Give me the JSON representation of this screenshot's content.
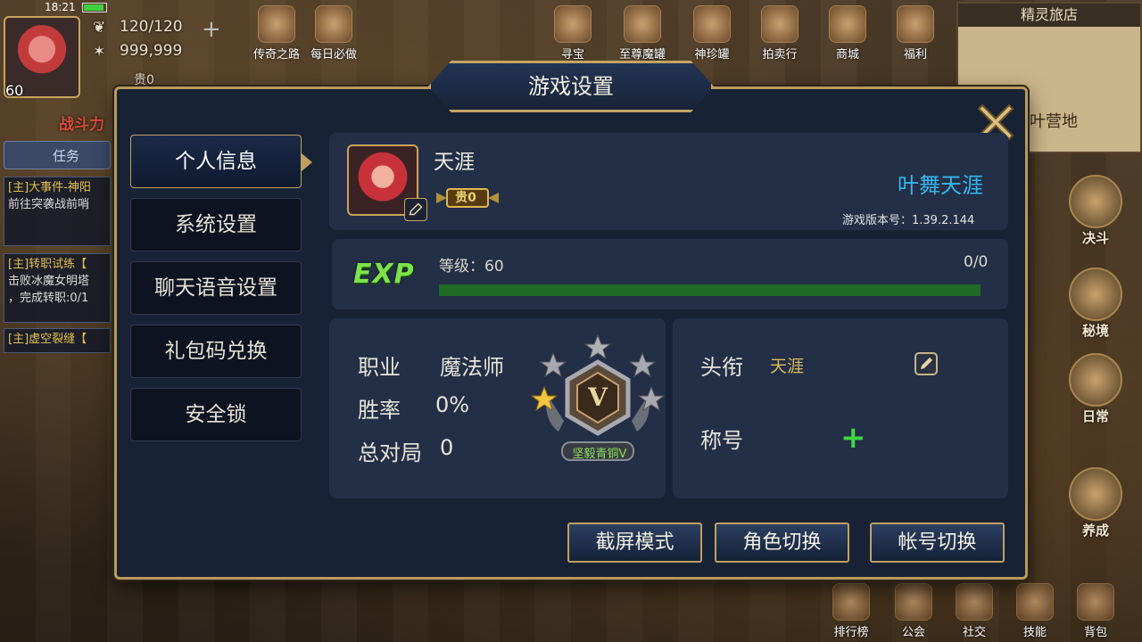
{
  "status_bar": {
    "time": "18:21"
  },
  "hud": {
    "level": "60",
    "stamina": "120/120",
    "gold": "999,999",
    "noble": "贵0",
    "battle_power_label": "战斗力",
    "task_tab": "任务",
    "quests": [
      {
        "title": "[主]大事件-神阳",
        "desc": "前往突袭战前哨"
      },
      {
        "title": "[主]转职试练【",
        "desc": "击败冰魔女明塔",
        "desc2": "，完成转职:0/1"
      },
      {
        "title": "[主]虚空裂缝【",
        "desc": ""
      }
    ]
  },
  "top_icons": [
    {
      "label": "传奇之路"
    },
    {
      "label": "每日必做"
    },
    {
      "label": "寻宝"
    },
    {
      "label": "至尊魔罐"
    },
    {
      "label": "神珍罐"
    },
    {
      "label": "拍卖行"
    },
    {
      "label": "商城"
    },
    {
      "label": "福利"
    }
  ],
  "minimap": {
    "title": "精灵旅店",
    "area": "叶营地"
  },
  "right_icons": [
    {
      "label": "决斗"
    },
    {
      "label": "秘境"
    },
    {
      "label": "日常"
    },
    {
      "label": "养成"
    }
  ],
  "bottom_icons": [
    {
      "label": "排行榜"
    },
    {
      "label": "公会"
    },
    {
      "label": "社交"
    },
    {
      "label": "技能"
    },
    {
      "label": "背包"
    }
  ],
  "dialog": {
    "title": "游戏设置",
    "nav": [
      {
        "label": "个人信息",
        "active": true
      },
      {
        "label": "系统设置"
      },
      {
        "label": "聊天语音设置"
      },
      {
        "label": "礼包码兑换"
      },
      {
        "label": "安全锁"
      }
    ],
    "profile": {
      "name": "天涯",
      "vip": "贵0",
      "server": "叶舞天涯",
      "version": "游戏版本号：1.39.2.144"
    },
    "exp": {
      "label": "EXP",
      "level_text": "等级：60",
      "value_text": "0/0",
      "progress": 1.0,
      "bar_color": "#1f6a25"
    },
    "stats": [
      {
        "label": "职业",
        "value": "魔法师"
      },
      {
        "label": "胜率",
        "value": "0%"
      },
      {
        "label": "总对局",
        "value": "0"
      }
    ],
    "rank": {
      "name": "坚毅青铜V",
      "tier": "V",
      "stars_filled": 1,
      "stars_total": 5
    },
    "titles": {
      "headtitle_label": "头衔",
      "headtitle_value": "天涯",
      "honor_label": "称号",
      "honor_add": "+"
    },
    "buttons": {
      "screenshot": "截屏模式",
      "switch_role": "角色切换",
      "switch_account": "帐号切换"
    }
  },
  "colors": {
    "accent_gold": "#c0a060",
    "server_blue": "#36b6f0",
    "exp_green": "#7de34a"
  }
}
